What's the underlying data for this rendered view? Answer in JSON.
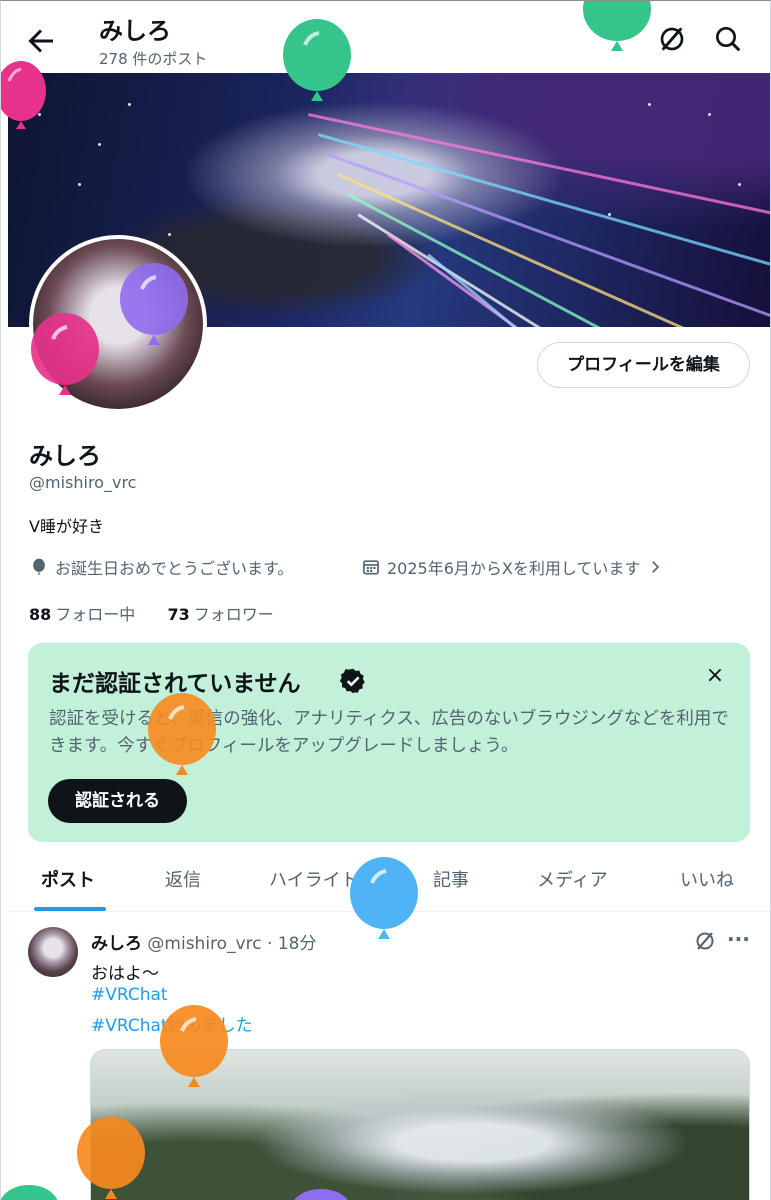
{
  "header": {
    "title": "みしろ",
    "post_count": "278 件のポスト"
  },
  "profile": {
    "edit_button": "プロフィールを編集",
    "name": "みしろ",
    "handle": "@mishiro_vrc",
    "bio": "V睡が好き",
    "birthday": "お誕生日おめでとうございます。",
    "joined": "2025年6月からXを利用しています",
    "following_count": "88",
    "following_label": "フォロー中",
    "followers_count": "73",
    "followers_label": "フォロワー"
  },
  "verify": {
    "title": "まだ認証されていません",
    "text": "認証を受けると、返信の強化、アナリティクス、広告のないブラウジングなどを利用できます。今すぐプロフィールをアップグレードしましょう。",
    "button": "認証される",
    "close": "×"
  },
  "tabs": [
    "ポスト",
    "返信",
    "ハイライト",
    "記事",
    "メディア",
    "いいね"
  ],
  "post": {
    "name": "みしろ",
    "handle": "@mishiro_vrc",
    "time": "· 18分",
    "text": "おはよ〜",
    "hashtag1": "#VRChat",
    "hashtag2": "#VRChat始めました",
    "more": "···"
  },
  "colors": {
    "accent": "#1d9bf0",
    "verify_bg": "#c2f0d9",
    "balloons": [
      "#e6328a",
      "#35c48a",
      "#8f6cf0",
      "#f68a1e",
      "#4fb3f6"
    ]
  },
  "icons": [
    "back-arrow-icon",
    "grok-icon",
    "search-icon",
    "balloon-icon",
    "calendar-icon",
    "chevron-right-icon",
    "verified-badge-icon",
    "close-icon",
    "more-icon"
  ]
}
